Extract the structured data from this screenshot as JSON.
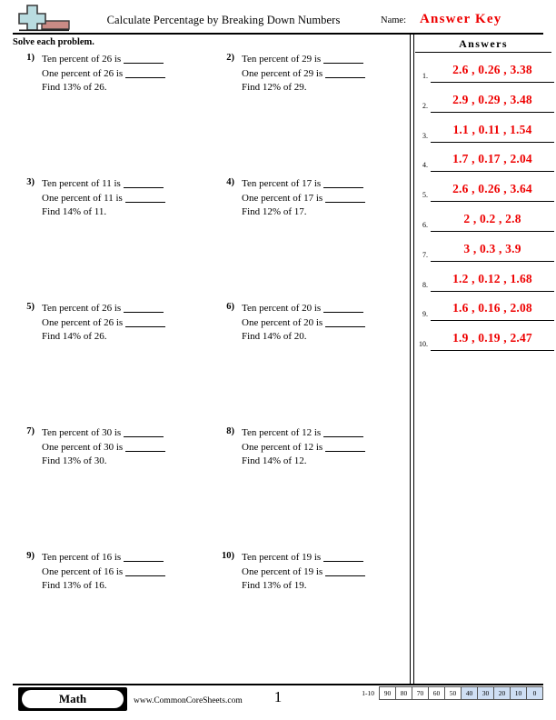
{
  "header": {
    "title": "Calculate Percentage by Breaking Down Numbers",
    "name_label": "Name:",
    "answer_key_text": "Answer Key",
    "answer_key_color": "#ee0000",
    "logo_icon": "plus-block-logo"
  },
  "instruction": "Solve each problem.",
  "problems": [
    {
      "num": "1)",
      "line1_pre": "Ten percent of 26 is",
      "line2_pre": "One percent of 26 is",
      "line3": "Find 13% of 26."
    },
    {
      "num": "2)",
      "line1_pre": "Ten percent of 29 is",
      "line2_pre": "One percent of 29 is",
      "line3": "Find 12% of 29."
    },
    {
      "num": "3)",
      "line1_pre": "Ten percent of 11 is",
      "line2_pre": "One percent of 11 is",
      "line3": "Find 14% of 11."
    },
    {
      "num": "4)",
      "line1_pre": "Ten percent of 17 is",
      "line2_pre": "One percent of 17 is",
      "line3": "Find 12% of 17."
    },
    {
      "num": "5)",
      "line1_pre": "Ten percent of 26 is",
      "line2_pre": "One percent of 26 is",
      "line3": "Find 14% of 26."
    },
    {
      "num": "6)",
      "line1_pre": "Ten percent of 20 is",
      "line2_pre": "One percent of 20 is",
      "line3": "Find 14% of 20."
    },
    {
      "num": "7)",
      "line1_pre": "Ten percent of 30 is",
      "line2_pre": "One percent of 30 is",
      "line3": "Find 13% of 30."
    },
    {
      "num": "8)",
      "line1_pre": "Ten percent of 12 is",
      "line2_pre": "One percent of 12 is",
      "line3": "Find 14% of 12."
    },
    {
      "num": "9)",
      "line1_pre": "Ten percent of 16 is",
      "line2_pre": "One percent of 16 is",
      "line3": "Find 13% of 16."
    },
    {
      "num": "10)",
      "line1_pre": "Ten percent of 19 is",
      "line2_pre": "One percent of 19 is",
      "line3": "Find 13% of 19."
    }
  ],
  "answers": {
    "title": "Answers",
    "items": [
      {
        "num": "1.",
        "value": "2.6 , 0.26 , 3.38"
      },
      {
        "num": "2.",
        "value": "2.9 , 0.29 , 3.48"
      },
      {
        "num": "3.",
        "value": "1.1 , 0.11 , 1.54"
      },
      {
        "num": "4.",
        "value": "1.7 , 0.17 , 2.04"
      },
      {
        "num": "5.",
        "value": "2.6 , 0.26 , 3.64"
      },
      {
        "num": "6.",
        "value": "2 , 0.2 , 2.8"
      },
      {
        "num": "7.",
        "value": "3 , 0.3 , 3.9"
      },
      {
        "num": "8.",
        "value": "1.2 , 0.12 , 1.68"
      },
      {
        "num": "9.",
        "value": "1.6 , 0.16 , 2.08"
      },
      {
        "num": "10.",
        "value": "1.9 , 0.19 , 2.47"
      }
    ]
  },
  "footer": {
    "subject_badge": "Math",
    "site_url": "www.CommonCoreSheets.com",
    "page_number": "1",
    "scale_label": "1-10",
    "scale_cells": [
      {
        "value": "90",
        "highlighted": false
      },
      {
        "value": "80",
        "highlighted": false
      },
      {
        "value": "70",
        "highlighted": false
      },
      {
        "value": "60",
        "highlighted": false
      },
      {
        "value": "50",
        "highlighted": false
      },
      {
        "value": "40",
        "highlighted": true
      },
      {
        "value": "30",
        "highlighted": true
      },
      {
        "value": "20",
        "highlighted": true
      },
      {
        "value": "10",
        "highlighted": true
      },
      {
        "value": "0",
        "highlighted": true
      }
    ],
    "scale_highlight_color": "#cfdff4"
  }
}
